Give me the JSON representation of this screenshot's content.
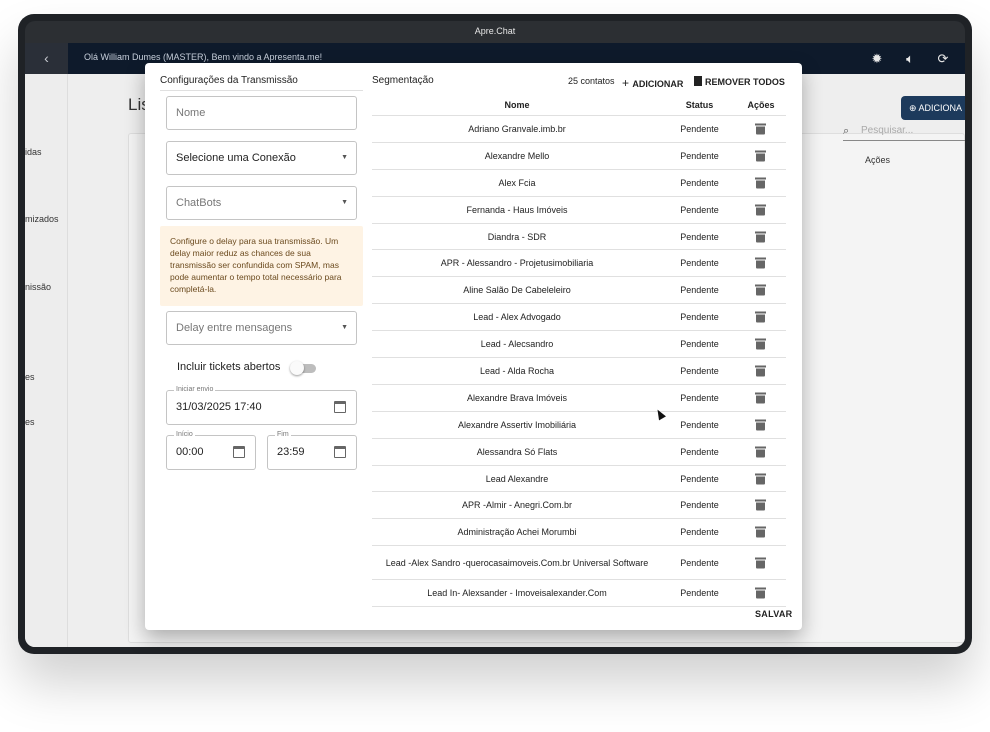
{
  "window": {
    "title": "Apre.Chat"
  },
  "appbar": {
    "back_icon": "chevron-left-icon",
    "welcome": "Olá William Dumes (MASTER), Bem vindo a Apresenta.me!",
    "icons": [
      "theme-icon",
      "volume-icon",
      "refresh-icon"
    ]
  },
  "sidebar": {
    "items": [
      "idas",
      "mizados",
      "nissão",
      "es",
      "es"
    ]
  },
  "background": {
    "title": "Lis",
    "add_button": "ADICIONA",
    "search_placeholder": "Pesquisar...",
    "col_actions": "Ações"
  },
  "modal": {
    "config_title": "Configurações da Transmissão",
    "name_placeholder": "Nome",
    "connection_select": "Selecione uma Conexão",
    "chatbots_select": "ChatBots",
    "delay_warning": "Configure o delay para sua transmissão. Um delay maior reduz as chances de sua transmissão ser confundida com SPAM, mas pode aumentar o tempo total necessário para completá-la.",
    "delay_select": "Delay entre mensagens",
    "include_tickets_label": "Incluir tickets abertos",
    "include_tickets_on": false,
    "start_send_label": "Iniciar envio",
    "start_send_value": "31/03/2025 17:40",
    "start_label": "Início",
    "start_value": "00:00",
    "end_label": "Fim",
    "end_value": "23:59",
    "save_label": "SALVAR"
  },
  "segmentation": {
    "title": "Segmentação",
    "count": "25 contatos",
    "add_label": "ADICIONAR",
    "remove_all_label": "REMOVER TODOS",
    "columns": {
      "name": "Nome",
      "status": "Status",
      "actions": "Ações"
    },
    "rows": [
      {
        "name": "Adriano Granvale.imb.br",
        "status": "Pendente"
      },
      {
        "name": "Alexandre Mello",
        "status": "Pendente"
      },
      {
        "name": "Alex Fcia",
        "status": "Pendente"
      },
      {
        "name": "Fernanda - Haus Imóveis",
        "status": "Pendente"
      },
      {
        "name": "Diandra - SDR",
        "status": "Pendente"
      },
      {
        "name": "APR - Alessandro - Projetusimobiliaria",
        "status": "Pendente"
      },
      {
        "name": "Aline Salão De Cabeleleiro",
        "status": "Pendente"
      },
      {
        "name": "Lead - Alex Advogado",
        "status": "Pendente"
      },
      {
        "name": "Lead - Alecsandro",
        "status": "Pendente"
      },
      {
        "name": "Lead - Alda Rocha",
        "status": "Pendente"
      },
      {
        "name": "Alexandre Brava Imóveis",
        "status": "Pendente"
      },
      {
        "name": "Alexandre Assertiv Imobiliária",
        "status": "Pendente"
      },
      {
        "name": "Alessandra Só Flats",
        "status": "Pendente"
      },
      {
        "name": "Lead Alexandre",
        "status": "Pendente"
      },
      {
        "name": "APR -Almir - Anegri.Com.br",
        "status": "Pendente"
      },
      {
        "name": "Administração Achei Morumbi",
        "status": "Pendente"
      },
      {
        "name": "Lead -Alex Sandro -querocasaimoveis.Com.br Universal Software",
        "status": "Pendente"
      },
      {
        "name": "Lead In- Alexsander - Imoveisalexander.Com",
        "status": "Pendente"
      }
    ]
  }
}
